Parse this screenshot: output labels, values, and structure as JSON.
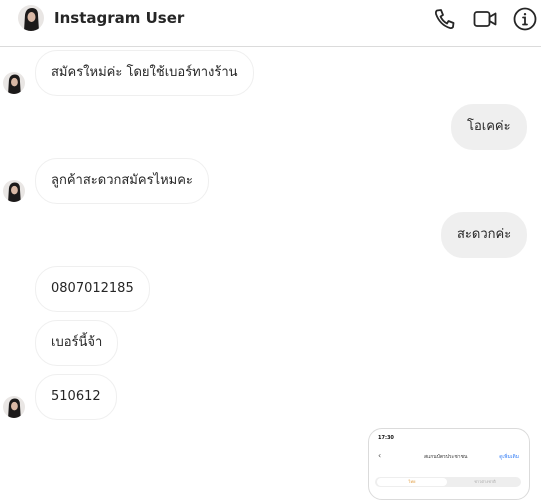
{
  "header": {
    "title": "Instagram User",
    "icons": [
      "phone-icon",
      "video-camera-icon",
      "info-icon"
    ]
  },
  "messages": [
    {
      "from": "them",
      "text": "สมัครใหม่ค่ะ โดยใช้เบอร์ทางร้าน"
    },
    {
      "from": "me",
      "text": "โอเคค่ะ"
    },
    {
      "from": "them",
      "text": "ลูกค้าสะดวกสมัครไหมคะ"
    },
    {
      "from": "me",
      "text": "สะดวกค่ะ"
    },
    {
      "from": "them",
      "text": "0807012185"
    },
    {
      "from": "them",
      "text": "เบอร์นี้จ้า"
    },
    {
      "from": "them",
      "text": "510612"
    }
  ],
  "attachment": {
    "status_time": "17:30",
    "title": "สแกนบัตรประชาชน",
    "action": "ดูเพิ่มเติม",
    "tab_active": "ไทย",
    "tab_other": "ชาวต่างชาติ"
  },
  "colors": {
    "my_bubble": "#efefef",
    "border": "#dbdbdb"
  }
}
